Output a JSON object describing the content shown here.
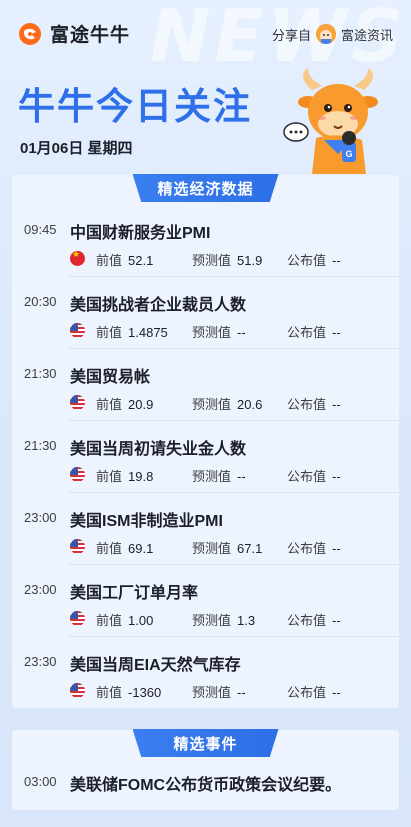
{
  "header": {
    "logo_text": "富途牛牛",
    "share_prefix": "分享自",
    "share_source": "富途资讯",
    "watermark": "NEWS",
    "headline": "牛牛今日关注",
    "date": "01月06日 星期四"
  },
  "colors": {
    "accent": "#2f6fe9",
    "logo_orange": "#ff6a1a",
    "ribbon": "#3a7ef0"
  },
  "econ": {
    "section_title": "精选经济数据",
    "labels": {
      "prev": "前值",
      "forecast": "预测值",
      "published": "公布值"
    },
    "items": [
      {
        "time": "09:45",
        "title": "中国财新服务业PMI",
        "flag": "cn-flag-icon",
        "prev": "52.1",
        "forecast": "51.9",
        "published": "--"
      },
      {
        "time": "20:30",
        "title": "美国挑战者企业裁员人数",
        "flag": "us-flag-icon",
        "prev": "1.4875",
        "forecast": "--",
        "published": "--"
      },
      {
        "time": "21:30",
        "title": "美国贸易帐",
        "flag": "us-flag-icon",
        "prev": "20.9",
        "forecast": "20.6",
        "published": "--"
      },
      {
        "time": "21:30",
        "title": "美国当周初请失业金人数",
        "flag": "us-flag-icon",
        "prev": "19.8",
        "forecast": "--",
        "published": "--"
      },
      {
        "time": "23:00",
        "title": "美国ISM非制造业PMI",
        "flag": "us-flag-icon",
        "prev": "69.1",
        "forecast": "67.1",
        "published": "--"
      },
      {
        "time": "23:00",
        "title": "美国工厂订单月率",
        "flag": "us-flag-icon",
        "prev": "1.00",
        "forecast": "1.3",
        "published": "--"
      },
      {
        "time": "23:30",
        "title": "美国当周EIA天然气库存",
        "flag": "us-flag-icon",
        "prev": "-1360",
        "forecast": "--",
        "published": "--"
      }
    ]
  },
  "events": {
    "section_title": "精选事件",
    "items": [
      {
        "time": "03:00",
        "title": "美联储FOMC公布货币政策会议纪要。"
      }
    ]
  }
}
